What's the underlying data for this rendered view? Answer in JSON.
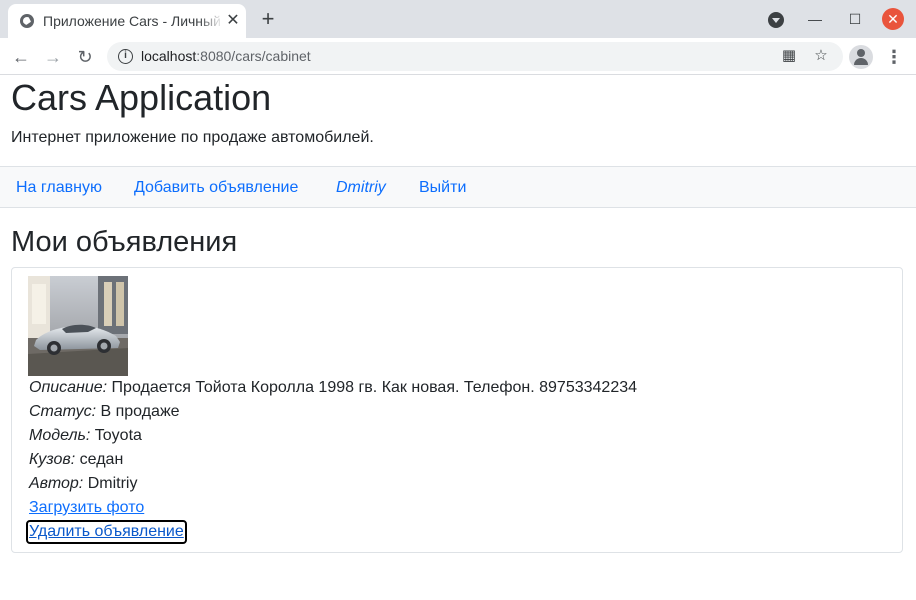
{
  "browser": {
    "tab_title": "Приложение Cars - Личный кабинет",
    "tab_close": "✕",
    "new_tab": "+",
    "url_host": "localhost",
    "url_path": ":8080/cars/cabinet"
  },
  "header": {
    "title": "Cars Application",
    "subtitle": "Интернет приложение по продаже автомобилей."
  },
  "nav": {
    "home": "На главную",
    "add_ad": "Добавить объявление",
    "user": "Dmitriy",
    "logout": "Выйти"
  },
  "main": {
    "title": "Мои объявления",
    "ads": [
      {
        "description_label": "Описание:",
        "description": "Продается Тойота Королла 1998 гв. Как новая. Телефон. 89753342234",
        "status_label": "Статус:",
        "status": "В продаже",
        "model_label": "Модель:",
        "model": "Toyota",
        "body_label": "Кузов:",
        "body": "седан",
        "author_label": "Автор:",
        "author": "Dmitriy",
        "upload_photo": "Загрузить фото",
        "delete_ad": "Удалить объявление"
      }
    ]
  },
  "colors": {
    "link": "#0d6efd",
    "navbar_bg": "#f8f9fa",
    "close_button": "#e9543c"
  }
}
